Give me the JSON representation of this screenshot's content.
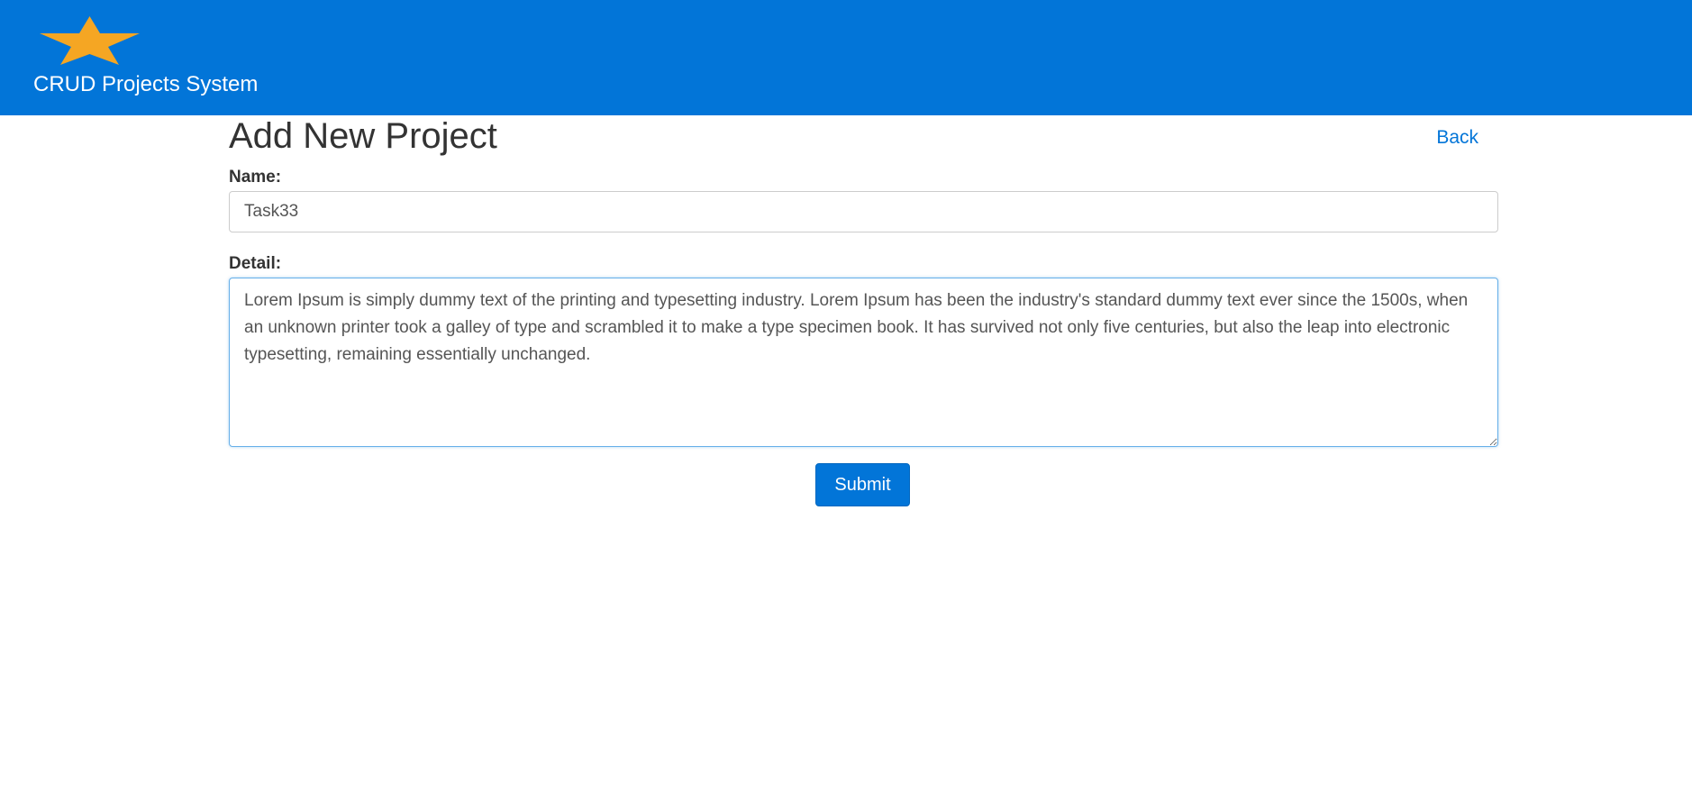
{
  "header": {
    "brand_title": "CRUD Projects System",
    "logo_icon": "star-icon",
    "background_color": "#0275d8",
    "logo_color": "#f5a623"
  },
  "main": {
    "page_title": "Add New Project",
    "back_label": "Back",
    "name_label": "Name:",
    "name_value": "Task33",
    "detail_label": "Detail:",
    "detail_value": "Lorem Ipsum is simply dummy text of the printing and typesetting industry. Lorem Ipsum has been the industry's standard dummy text ever since the 1500s, when an unknown printer took a galley of type and scrambled it to make a type specimen book. It has survived not only five centuries, but also the leap into electronic typesetting, remaining essentially unchanged. ",
    "submit_label": "Submit"
  }
}
